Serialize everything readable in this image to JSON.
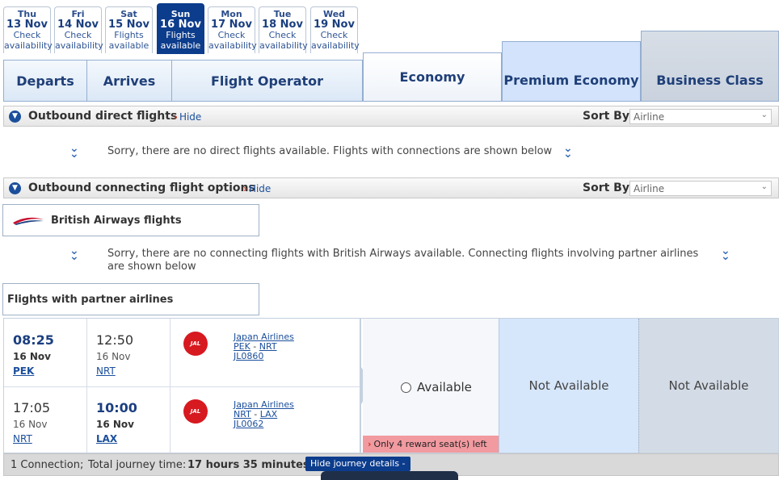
{
  "date_tabs": [
    {
      "dow": "Thu",
      "date": "13 Nov",
      "status": "Check availability",
      "selected": false
    },
    {
      "dow": "Fri",
      "date": "14 Nov",
      "status": "Check availability",
      "selected": false
    },
    {
      "dow": "Sat",
      "date": "15 Nov",
      "status": "Flights available",
      "selected": false
    },
    {
      "dow": "Sun",
      "date": "16 Nov",
      "status": "Flights available",
      "selected": true
    },
    {
      "dow": "Mon",
      "date": "17 Nov",
      "status": "Check availability",
      "selected": false
    },
    {
      "dow": "Tue",
      "date": "18 Nov",
      "status": "Check availability",
      "selected": false
    },
    {
      "dow": "Wed",
      "date": "19 Nov",
      "status": "Check availability",
      "selected": false
    }
  ],
  "columns": {
    "departs": "Departs",
    "arrives": "Arrives",
    "operator": "Flight Operator"
  },
  "cabins": {
    "economy": "Economy",
    "premium": "Premium Economy",
    "business": "Business Class"
  },
  "direct": {
    "title": "Outbound direct flights",
    "hide": "Hide",
    "sort_label": "Sort By",
    "sort_value": "Airline",
    "message": "Sorry, there are no direct flights available. Flights with connections are shown below"
  },
  "connecting": {
    "title": "Outbound connecting flight options",
    "hide": "Hide",
    "sort_label": "Sort By",
    "sort_value": "Airline"
  },
  "ba": {
    "title": "British Airways flights",
    "message": "Sorry, there are no connecting flights with British Airways available. Connecting flights involving partner airlines are shown below"
  },
  "partner": {
    "title": "Flights with partner airlines"
  },
  "segments": [
    {
      "dep_time": "08:25",
      "dep_date": "16 Nov",
      "dep_code": "PEK",
      "arr_time": "12:50",
      "arr_date": "16 Nov",
      "arr_code": "NRT",
      "airline": "Japan Airlines",
      "from": "PEK",
      "to": "NRT",
      "flight": "JL0860",
      "logo_text": "JAL"
    },
    {
      "dep_time": "17:05",
      "dep_date": "16 Nov",
      "dep_code": "NRT",
      "arr_time": "10:00",
      "arr_date": "16 Nov",
      "arr_code": "LAX",
      "airline": "Japan Airlines",
      "from": "NRT",
      "to": "LAX",
      "flight": "JL0062",
      "logo_text": "JAL"
    }
  ],
  "availability": {
    "economy": "Available",
    "economy_note": "Only 4 reward seat(s) left",
    "premium": "Not Available",
    "business": "Not Available"
  },
  "footer": {
    "connections": "1 Connection;",
    "journey_label": "Total journey time:",
    "journey_time": "17 hours 35 minutes",
    "details_button": "Hide journey details -"
  },
  "colors": {
    "accent": "#0c3c8c",
    "premium_bg": "#d6e6fb",
    "business_bg": "#d3dbe6",
    "warning_bg": "#f19aa0"
  }
}
